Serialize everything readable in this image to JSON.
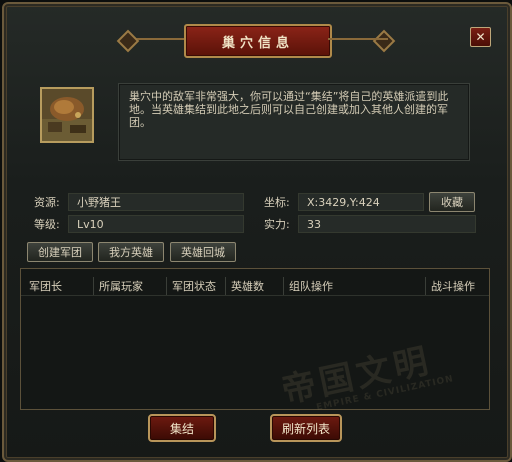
{
  "dialog": {
    "title": "巢穴信息",
    "close_label": "✕"
  },
  "description": "巢穴中的敌军非常强大，你可以通过“集结”将自己的英雄派遣到此地。当英雄集结到此地之后则可以自己创建或加入其他人创建的军团。",
  "info": {
    "resource_label": "资源:",
    "resource_value": "小野猪王",
    "level_label": "等级:",
    "level_value": "Lv10",
    "coord_label": "坐标:",
    "coord_value": "X:3429,Y:424",
    "strength_label": "实力:",
    "strength_value": "33",
    "favorite_button": "收藏"
  },
  "actions": {
    "create_legion": "创建军团",
    "my_heroes": "我方英雄",
    "hero_return": "英雄回城"
  },
  "table": {
    "columns": [
      "军团长",
      "所属玩家",
      "军团状态",
      "英雄数",
      "组队操作",
      "战斗操作"
    ],
    "rows": []
  },
  "watermark": {
    "main": "帝国文明",
    "sub": "EMPIRE & CIVILIZATION"
  },
  "footer": {
    "rally_button": "集结",
    "refresh_button": "刷新列表"
  },
  "colors": {
    "accent_red": "#8b2418",
    "gold_border": "#b8955a",
    "panel_bg": "#252a27"
  }
}
